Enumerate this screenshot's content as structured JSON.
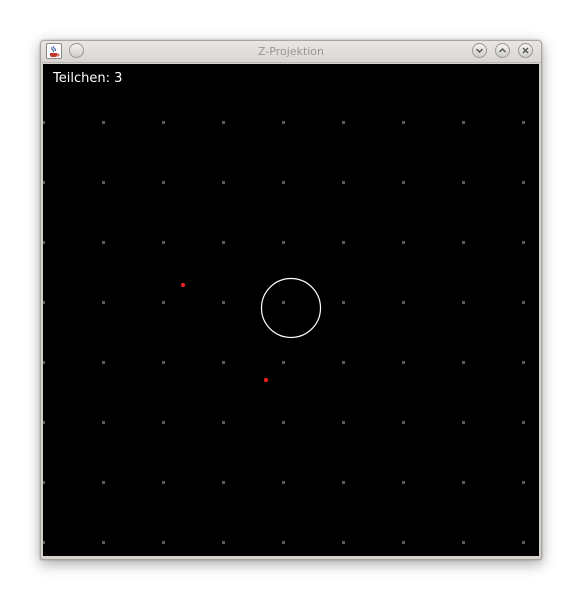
{
  "window": {
    "title": "Z-Projektion"
  },
  "hud": {
    "counter_label": "Teilchen:",
    "counter_value": "3"
  },
  "icons": {
    "app": "java-coffee-cup-icon",
    "pin": "pin-icon",
    "minimize": "chevron-down-icon",
    "maximize": "chevron-up-icon",
    "close": "close-icon"
  },
  "colors": {
    "background": "#000000",
    "grid_dot": "#5a5a5a",
    "particle": "#ff2020",
    "ring": "#ffffff",
    "text": "#ffffff"
  }
}
